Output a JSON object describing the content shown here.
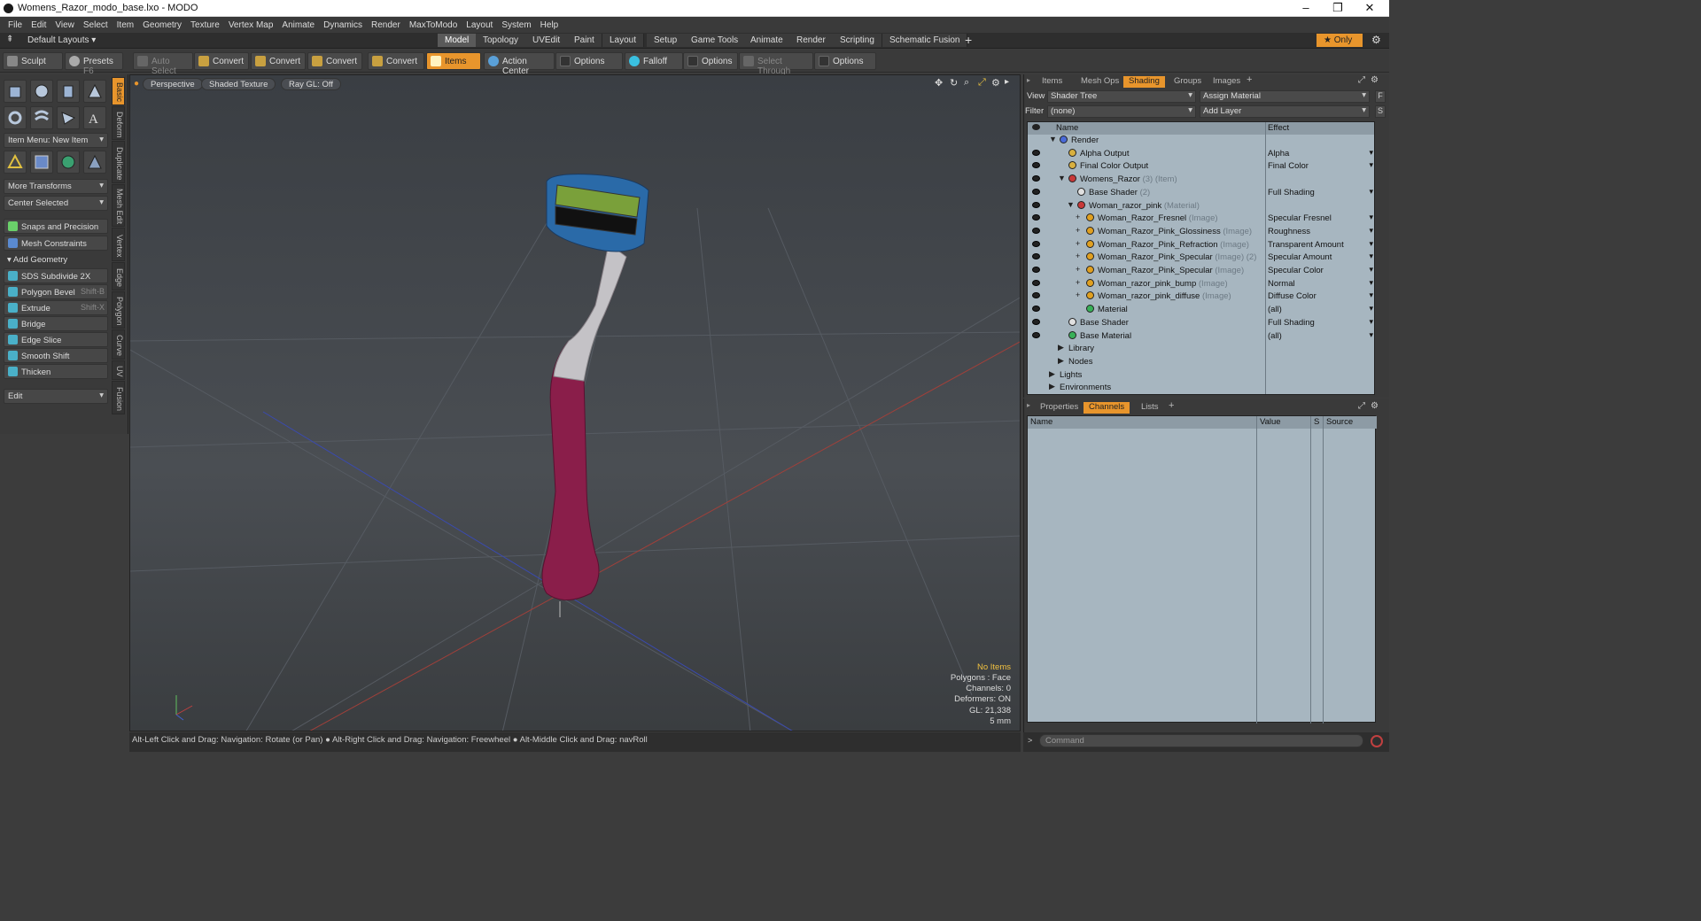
{
  "window": {
    "title": "Womens_Razor_modo_base.lxo - MODO"
  },
  "menu": [
    "File",
    "Edit",
    "View",
    "Select",
    "Item",
    "Geometry",
    "Texture",
    "Vertex Map",
    "Animate",
    "Dynamics",
    "Render",
    "MaxToModo",
    "Layout",
    "System",
    "Help"
  ],
  "layout_bar": {
    "layout_name": "Default Layouts",
    "tabs": [
      "Model",
      "Topology",
      "UVEdit",
      "Paint",
      "Layout",
      "Setup",
      "Game Tools",
      "Animate",
      "Render",
      "Scripting",
      "Schematic Fusion"
    ],
    "active_tab": "Model",
    "only_label": "Only"
  },
  "toolbar": {
    "sculpt": "Sculpt",
    "presets": "Presets",
    "presets_shortcut": "F6",
    "auto_select": "Auto Select",
    "convert1": "Convert",
    "convert2": "Convert",
    "convert3": "Convert",
    "convert4": "Convert",
    "items": "Items",
    "action_center": "Action Center",
    "options1": "Options",
    "falloff": "Falloff",
    "options2": "Options",
    "select_through": "Select Through",
    "options3": "Options"
  },
  "left_panel": {
    "item_menu": "Item Menu: New Item",
    "more_transforms": "More Transforms",
    "center_selected": "Center Selected",
    "snaps": "Snaps and Precision",
    "mesh_constraints": "Mesh Constraints",
    "add_geometry": "Add Geometry",
    "tools": [
      {
        "label": "SDS Subdivide 2X",
        "shortcut": ""
      },
      {
        "label": "Polygon Bevel",
        "shortcut": "Shift-B"
      },
      {
        "label": "Extrude",
        "shortcut": "Shift-X"
      },
      {
        "label": "Bridge",
        "shortcut": ""
      },
      {
        "label": "Edge Slice",
        "shortcut": ""
      },
      {
        "label": "Smooth Shift",
        "shortcut": ""
      },
      {
        "label": "Thicken",
        "shortcut": ""
      }
    ],
    "edit_dropdown": "Edit",
    "vertical_tabs": [
      "Basic",
      "Deform",
      "Duplicate",
      "Mesh Edit",
      "Vertex",
      "Edge",
      "Polygon",
      "Curve",
      "UV",
      "Fusion"
    ]
  },
  "viewport": {
    "view_mode": "Perspective",
    "shading": "Shaded Texture",
    "raygl": "Ray GL: Off",
    "hud": {
      "selection": "No Items",
      "polygons": "Polygons : Face",
      "channels": "Channels: 0",
      "deformers": "Deformers: ON",
      "gl": "GL: 21,338",
      "scale": "5 mm"
    }
  },
  "status_bar": {
    "hint1": "Alt-Left Click and Drag: Navigation: Rotate (or Pan)",
    "hint2": "Alt-Right Click and Drag: Navigation: Freewheel",
    "hint3": "Alt-Middle Click and Drag: navRoll"
  },
  "shader_panel": {
    "tabs": [
      "Items",
      "Mesh Ops",
      "Shading",
      "Groups",
      "Images"
    ],
    "active_tab": "Shading",
    "view_label": "View",
    "view_value": "Shader Tree",
    "assign_material": "Assign Material",
    "filter_label": "Filter",
    "filter_value": "(none)",
    "add_layer": "Add Layer",
    "col_name": "Name",
    "col_effect": "Effect",
    "rows": [
      {
        "name": "Render",
        "sub": "",
        "effect": "",
        "ball": "#4a6ad8",
        "indent": 0,
        "eye": false,
        "exp": "▼"
      },
      {
        "name": "Alpha Output",
        "sub": "",
        "effect": "Alpha",
        "ball": "#d8b040",
        "indent": 1,
        "eye": true,
        "exp": ""
      },
      {
        "name": "Final Color Output",
        "sub": "",
        "effect": "Final Color",
        "ball": "#d8b040",
        "indent": 1,
        "eye": true,
        "exp": ""
      },
      {
        "name": "Womens_Razor",
        "sub": "(3) (Item)",
        "effect": "",
        "ball": "#c83838",
        "indent": 1,
        "eye": true,
        "exp": "▼"
      },
      {
        "name": "Base Shader",
        "sub": "(2)",
        "effect": "Full Shading",
        "ball": "#e0e0e0",
        "indent": 2,
        "eye": true,
        "exp": ""
      },
      {
        "name": "Woman_razor_pink",
        "sub": "(Material)",
        "effect": "",
        "ball": "#c83838",
        "indent": 2,
        "eye": true,
        "exp": "▼"
      },
      {
        "name": "Woman_Razor_Fresnel",
        "sub": "(Image)",
        "effect": "Specular Fresnel",
        "ball": "#e0a020",
        "indent": 3,
        "eye": true,
        "exp": "+"
      },
      {
        "name": "Woman_Razor_Pink_Glossiness",
        "sub": "(Image)",
        "effect": "Roughness",
        "ball": "#e0a020",
        "indent": 3,
        "eye": true,
        "exp": "+"
      },
      {
        "name": "Woman_Razor_Pink_Refraction",
        "sub": "(Image)",
        "effect": "Transparent Amount",
        "ball": "#e0a020",
        "indent": 3,
        "eye": true,
        "exp": "+"
      },
      {
        "name": "Woman_Razor_Pink_Specular",
        "sub": "(Image) (2)",
        "effect": "Specular Amount",
        "ball": "#e0a020",
        "indent": 3,
        "eye": true,
        "exp": "+"
      },
      {
        "name": "Woman_Razor_Pink_Specular",
        "sub": "(Image)",
        "effect": "Specular Color",
        "ball": "#e0a020",
        "indent": 3,
        "eye": true,
        "exp": "+"
      },
      {
        "name": "Woman_razor_pink_bump",
        "sub": "(Image)",
        "effect": "Normal",
        "ball": "#e0a020",
        "indent": 3,
        "eye": true,
        "exp": "+"
      },
      {
        "name": "Woman_razor_pink_diffuse",
        "sub": "(Image)",
        "effect": "Diffuse Color",
        "ball": "#e0a020",
        "indent": 3,
        "eye": true,
        "exp": "+"
      },
      {
        "name": "Material",
        "sub": "",
        "effect": "(all)",
        "ball": "#38b058",
        "indent": 3,
        "eye": true,
        "exp": ""
      },
      {
        "name": "Base Shader",
        "sub": "",
        "effect": "Full Shading",
        "ball": "#e0e0e0",
        "indent": 1,
        "eye": true,
        "exp": ""
      },
      {
        "name": "Base Material",
        "sub": "",
        "effect": "(all)",
        "ball": "#38b058",
        "indent": 1,
        "eye": true,
        "exp": ""
      },
      {
        "name": "Library",
        "sub": "",
        "effect": "",
        "ball": "",
        "indent": 1,
        "eye": false,
        "exp": "▶"
      },
      {
        "name": "Nodes",
        "sub": "",
        "effect": "",
        "ball": "",
        "indent": 1,
        "eye": false,
        "exp": "▶"
      },
      {
        "name": "Lights",
        "sub": "",
        "effect": "",
        "ball": "",
        "indent": 0,
        "eye": false,
        "exp": "▶"
      },
      {
        "name": "Environments",
        "sub": "",
        "effect": "",
        "ball": "",
        "indent": 0,
        "eye": false,
        "exp": "▶"
      }
    ]
  },
  "channels_panel": {
    "tabs": [
      "Properties",
      "Channels",
      "Lists"
    ],
    "active_tab": "Channels",
    "col_name": "Name",
    "col_value": "Value",
    "col_s": "S",
    "col_source": "Source"
  },
  "command": {
    "placeholder": "Command"
  }
}
